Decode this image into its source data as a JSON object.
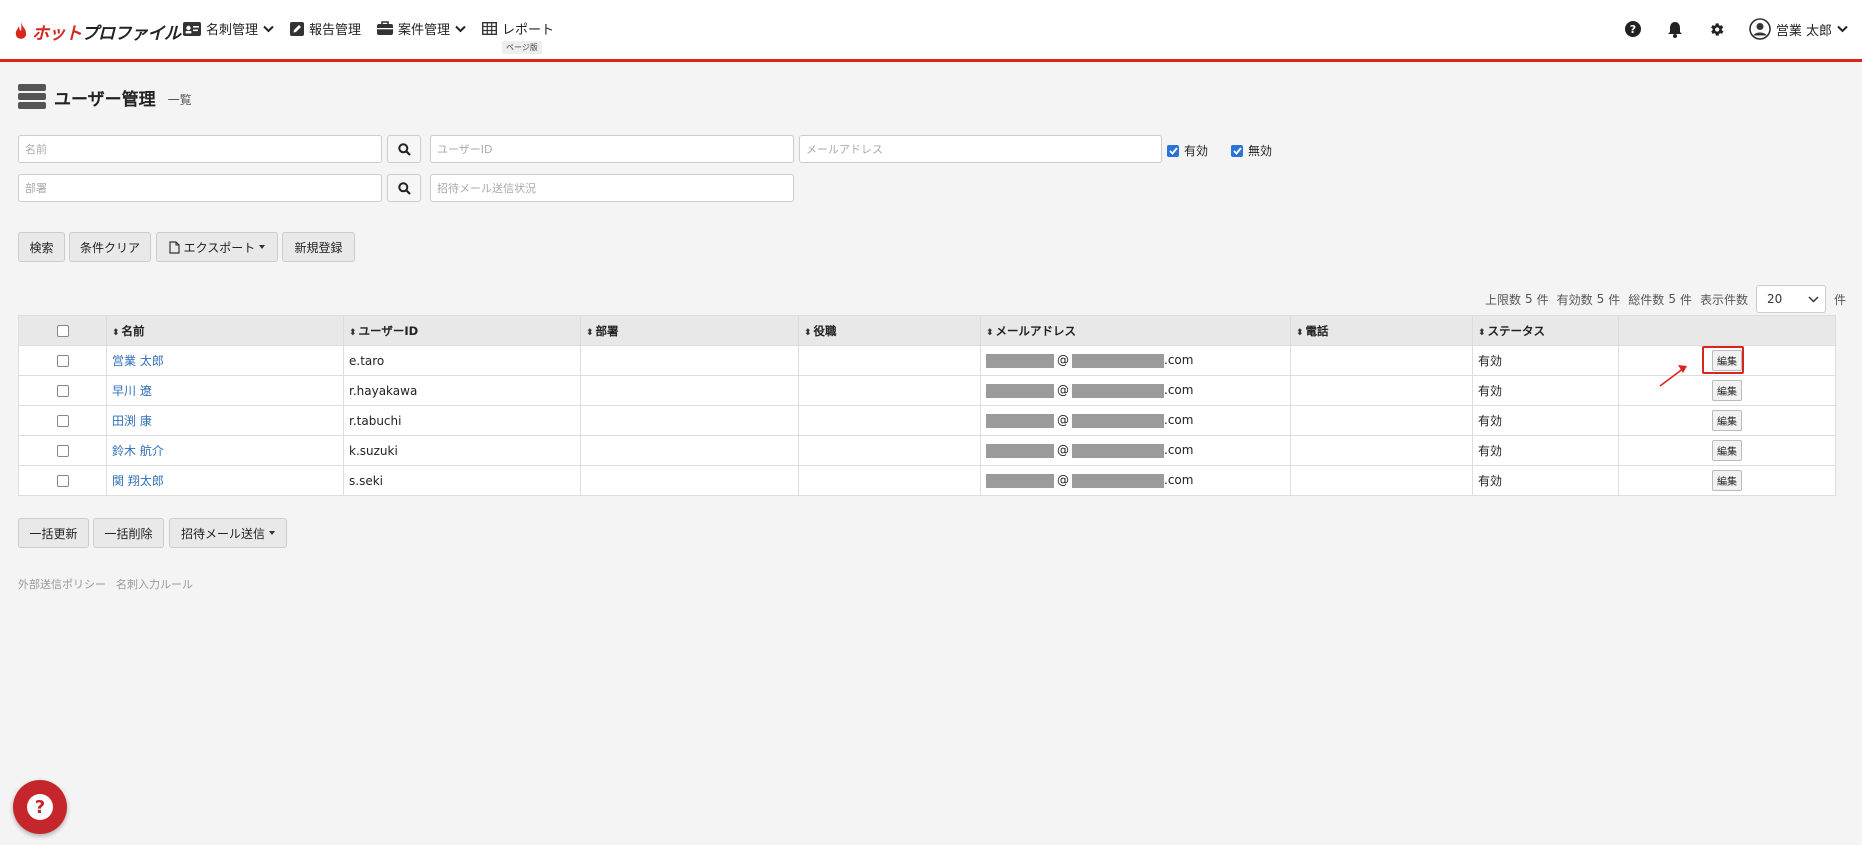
{
  "brand": {
    "name_hot": "ホット",
    "name_rest": "プロファイル",
    "accent": "#d7261e"
  },
  "nav": [
    {
      "label": "名刺管理",
      "has_caret": true
    },
    {
      "label": "報告管理",
      "has_caret": false
    },
    {
      "label": "案件管理",
      "has_caret": true
    },
    {
      "label": "レポート",
      "has_caret": false,
      "badge": "ページ版"
    }
  ],
  "header": {
    "user_name": "営業 太郎"
  },
  "page": {
    "title": "ユーザー管理",
    "subtitle": "一覧"
  },
  "search": {
    "name_placeholder": "名前",
    "userid_placeholder": "ユーザーID",
    "email_placeholder": "メールアドレス",
    "dept_placeholder": "部署",
    "invite_placeholder": "招待メール送信状況",
    "active_label": "有効",
    "inactive_label": "無効"
  },
  "toolbar": {
    "search_label": "検索",
    "clear_label": "条件クリア",
    "export_label": "エクスポート",
    "new_label": "新規登録"
  },
  "pagination": {
    "limit_label": "上限数",
    "limit_value": "5",
    "unit1": "件",
    "active_label": "有効数",
    "active_value": "5",
    "unit2": "件",
    "total_label": "総件数",
    "total_value": "5",
    "unit3": "件",
    "display_label": "表示件数",
    "display_value": "20",
    "unit4": "件"
  },
  "table": {
    "headers": [
      "名前",
      "ユーザーID",
      "部署",
      "役職",
      "メールアドレス",
      "電話",
      "ステータス"
    ],
    "rows": [
      {
        "name": "営業 太郎",
        "userid": "e.taro",
        "dept": "",
        "role": "",
        "email_at": "@",
        "email_tld": ".com",
        "phone": "",
        "status": "有効",
        "edit": "編集"
      },
      {
        "name": "早川 遼",
        "userid": "r.hayakawa",
        "dept": "",
        "role": "",
        "email_at": "@",
        "email_tld": ".com",
        "phone": "",
        "status": "有効",
        "edit": "編集"
      },
      {
        "name": "田渕 康",
        "userid": "r.tabuchi",
        "dept": "",
        "role": "",
        "email_at": "@",
        "email_tld": ".com",
        "phone": "",
        "status": "有効",
        "edit": "編集"
      },
      {
        "name": "鈴木 航介",
        "userid": "k.suzuki",
        "dept": "",
        "role": "",
        "email_at": "@",
        "email_tld": ".com",
        "phone": "",
        "status": "有効",
        "edit": "編集"
      },
      {
        "name": "関 翔太郎",
        "userid": "s.seki",
        "dept": "",
        "role": "",
        "email_at": "@",
        "email_tld": ".com",
        "phone": "",
        "status": "有効",
        "edit": "編集"
      }
    ]
  },
  "bulk": {
    "update_label": "一括更新",
    "delete_label": "一括削除",
    "invite_label": "招待メール送信"
  },
  "footer": {
    "policy_link": "外部送信ポリシー",
    "rule_link": "名刺入力ルール"
  },
  "icons": {
    "card": "id-card-icon",
    "report": "pencil-square-icon",
    "deal": "briefcase-icon",
    "grid": "table-grid-icon",
    "help": "question-circle-icon",
    "bell": "bell-icon",
    "gear": "gear-icon",
    "user": "user-circle-icon"
  }
}
